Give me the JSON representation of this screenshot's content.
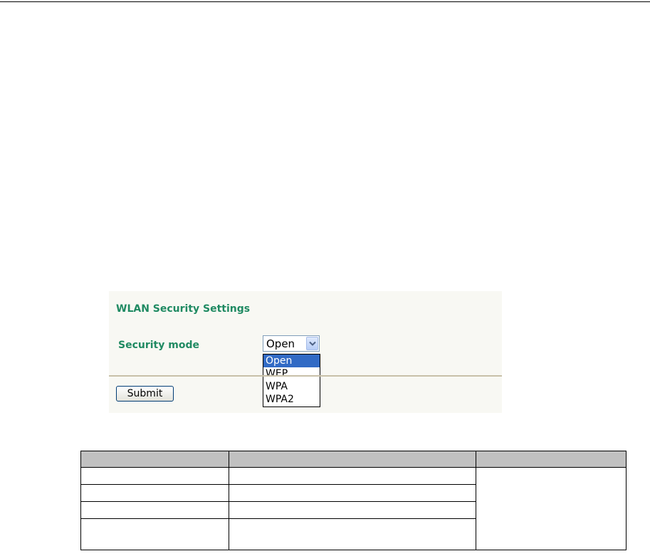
{
  "wlan_panel": {
    "title": "WLAN Security Settings",
    "security_mode_label": "Security mode",
    "security_mode_value": "Open",
    "security_mode_options": [
      "Open",
      "WEP",
      "WPA",
      "WPA2"
    ],
    "highlighted_option": "Open",
    "submit_label": "Submit"
  },
  "table": {
    "header_background": "#c0c0c0",
    "columns": 3,
    "body_rows": 4,
    "third_column_merged": true
  },
  "colors": {
    "heading_green": "#1f8a62",
    "selection_blue": "#316ac5"
  }
}
